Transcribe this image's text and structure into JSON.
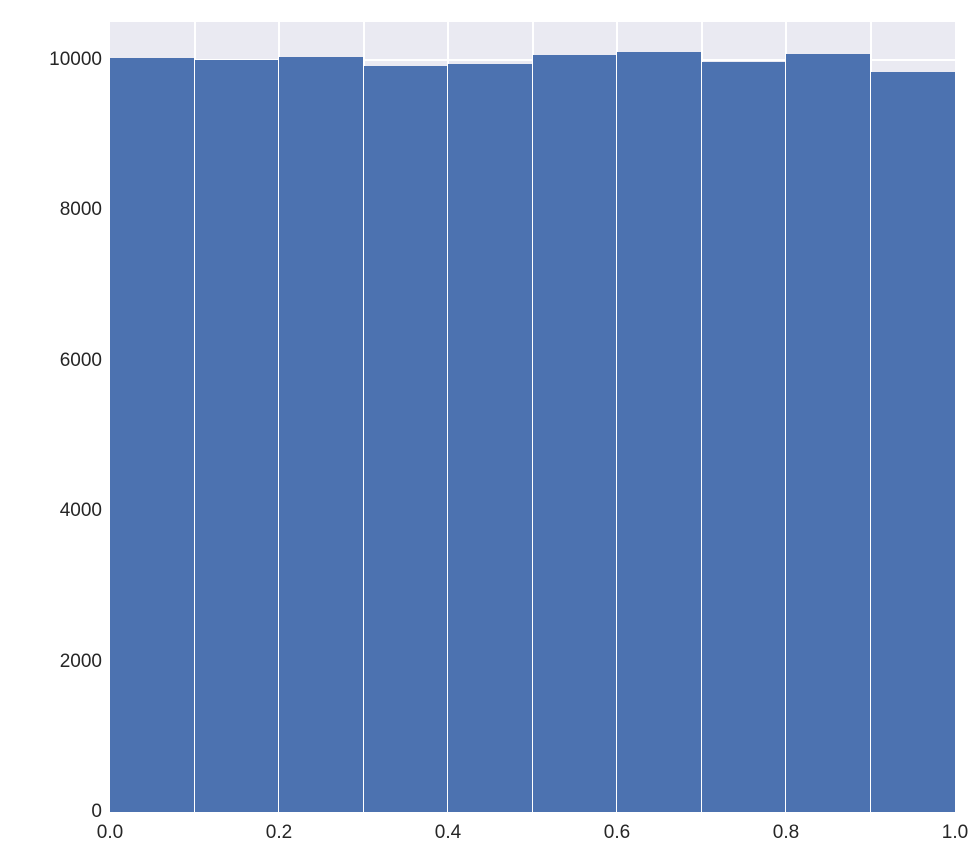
{
  "chart_data": {
    "type": "bar",
    "categories": [
      0.05,
      0.15,
      0.25,
      0.35,
      0.45,
      0.55,
      0.65,
      0.75,
      0.85,
      0.95
    ],
    "bin_edges": [
      0.0,
      0.1,
      0.2,
      0.3,
      0.4,
      0.5,
      0.6,
      0.7,
      0.8,
      0.9,
      1.0
    ],
    "values": [
      10020,
      9990,
      10040,
      9920,
      9940,
      10060,
      10100,
      9970,
      10070,
      9840
    ],
    "title": "",
    "xlabel": "",
    "ylabel": "",
    "xlim": [
      0.0,
      1.0
    ],
    "ylim": [
      0,
      10500
    ],
    "x_ticks": [
      0.0,
      0.2,
      0.4,
      0.6,
      0.8,
      1.0
    ],
    "x_tick_labels": [
      "0.0",
      "0.2",
      "0.4",
      "0.6",
      "0.8",
      "1.0"
    ],
    "y_ticks": [
      0,
      2000,
      4000,
      6000,
      8000,
      10000
    ],
    "y_tick_labels": [
      "0",
      "2000",
      "4000",
      "6000",
      "8000",
      "10000"
    ],
    "bar_color": "#4c72b0",
    "bg_color": "#eaeaf2",
    "grid_color": "#ffffff"
  }
}
